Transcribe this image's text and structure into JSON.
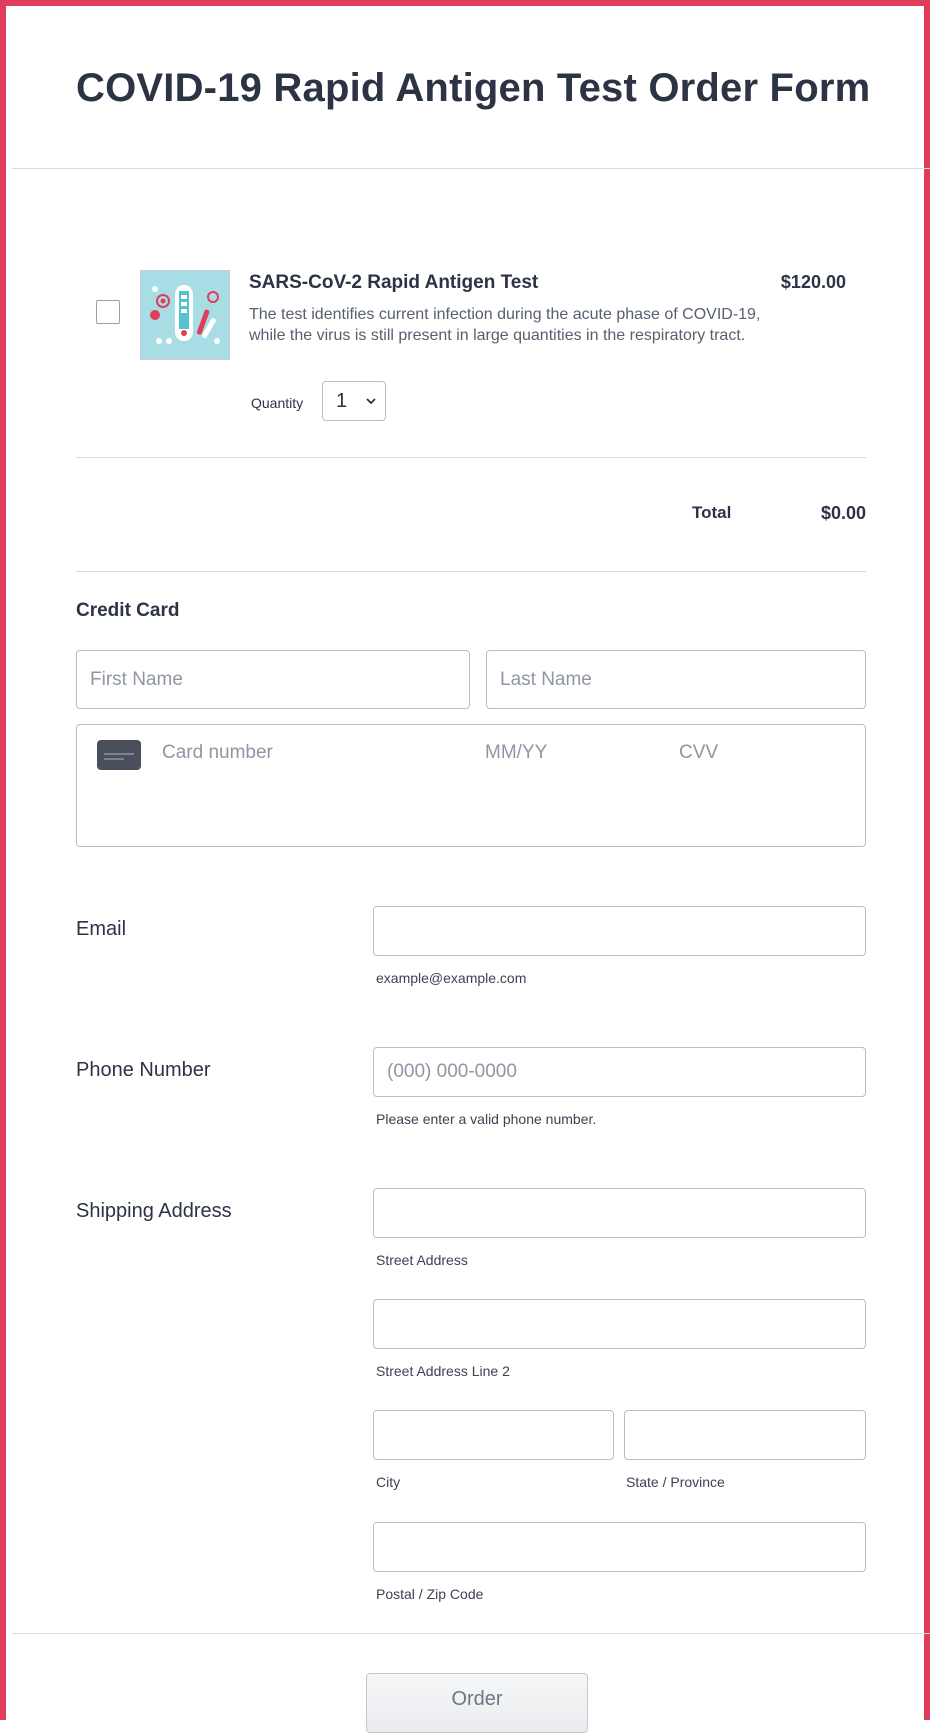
{
  "form": {
    "title": "COVID-19 Rapid Antigen Test Order Form"
  },
  "product": {
    "name": "SARS-CoV-2 Rapid Antigen Test",
    "price": "$120.00",
    "description": "The test identifies current infection during the acute phase of COVID-19, while the virus is still present in large quantities in the respiratory tract.",
    "quantity_label": "Quantity",
    "quantity_value": "1",
    "image_icon": "antigen-test-kit-illustration"
  },
  "total": {
    "label": "Total",
    "value": "$0.00"
  },
  "credit_card": {
    "title": "Credit Card",
    "first_name_placeholder": "First Name",
    "last_name_placeholder": "Last Name",
    "card_number_placeholder": "Card number",
    "expiry_placeholder": "MM/YY",
    "cvv_placeholder": "CVV",
    "card_icon": "credit-card-icon"
  },
  "email": {
    "label": "Email",
    "value": "",
    "sublabel": "example@example.com"
  },
  "phone": {
    "label": "Phone Number",
    "placeholder": "(000) 000-0000",
    "sublabel": "Please enter a valid phone number."
  },
  "shipping": {
    "label": "Shipping Address",
    "street_sublabel": "Street Address",
    "street2_sublabel": "Street Address Line 2",
    "city_sublabel": "City",
    "state_sublabel": "State / Province",
    "zip_sublabel": "Postal / Zip Code"
  },
  "submit": {
    "label": "Order"
  },
  "colors": {
    "accent_border": "#e03c5b",
    "text": "#2c3345",
    "placeholder": "#8f96a3"
  }
}
